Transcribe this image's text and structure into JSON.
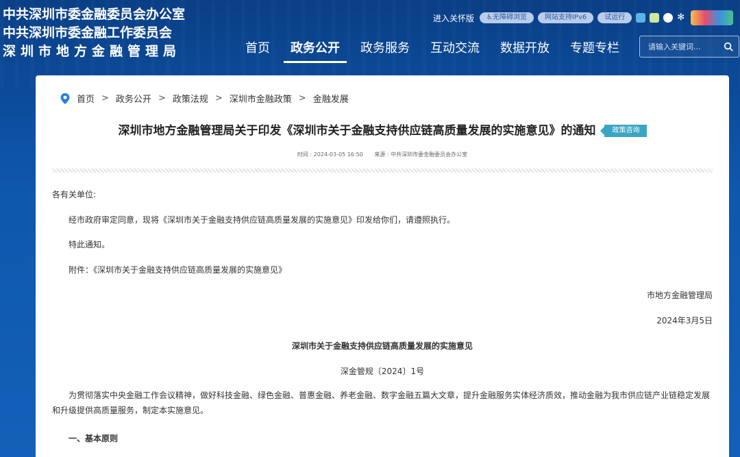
{
  "header": {
    "org_lines": [
      "中共深圳市委金融委员会办公室",
      "中共深圳市委金融工作委员会",
      "深圳市地方金融管理局"
    ],
    "care_link": "进入关怀版",
    "pills": [
      "无障碍浏览",
      "网站支持IPv6",
      "试运行"
    ],
    "nav": [
      "首页",
      "政务公开",
      "政务服务",
      "互动交流",
      "数据开放",
      "专题专栏"
    ],
    "active_nav": "政务公开",
    "search_placeholder": "请输入关键词..."
  },
  "breadcrumb": [
    "首页",
    "政务公开",
    "政策法规",
    "深圳市金融政策",
    "金融发展"
  ],
  "article": {
    "title": "深圳市地方金融管理局关于印发《深圳市关于金融支持供应链高质量发展的实施意见》的通知",
    "tag": "政策咨询",
    "time": "时间 : 2024-03-05 16:50",
    "source": "来源 : 中共深圳市委金融委员会办公室",
    "salutation": "各有关单位:",
    "para1": "经市政府审定同意，现将《深圳市关于金融支持供应链高质量发展的实施意见》印发给你们，请遵照执行。",
    "para2": "特此通知。",
    "attachment": "附件：《深圳市关于金融支持供应链高质量发展的实施意见》",
    "signer": "市地方金融管理局",
    "date": "2024年3月5日",
    "subtitle": "深圳市关于金融支持供应链高质量发展的实施意见",
    "doc_no": "深金管规〔2024〕1号",
    "intro": "为贯彻落实中央金融工作会议精神，做好科技金融、绿色金融、普惠金融、养老金融、数字金融五篇大文章，提升金融服务实体经济质效，推动金融为我市供应链产业链稳定发展和升级提供高质量服务，制定本实施意见。",
    "section1": "一、基本原则"
  }
}
